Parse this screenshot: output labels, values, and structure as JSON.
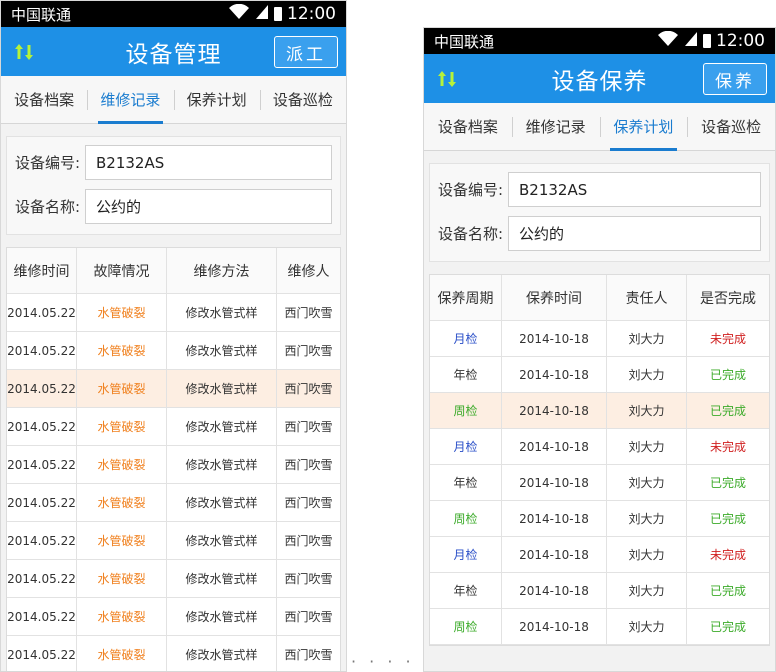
{
  "left": {
    "status": {
      "carrier": "中国联通",
      "time": "12:00"
    },
    "appbar": {
      "title": "设备管理",
      "action": "派工"
    },
    "tabs": [
      "设备档案",
      "维修记录",
      "保养计划",
      "设备巡检"
    ],
    "active_tab": 1,
    "form": [
      {
        "label": "设备编号:",
        "value": "B2132AS"
      },
      {
        "label": "设备名称:",
        "value": "公约的"
      }
    ],
    "table": {
      "headers": [
        "维修时间",
        "故障情况",
        "维修方法",
        "维修人"
      ],
      "highlight_row": 2,
      "rows": [
        [
          "2014.05.22",
          "水管破裂",
          "修改水管式样",
          "西门吹雪"
        ],
        [
          "2014.05.22",
          "水管破裂",
          "修改水管式样",
          "西门吹雪"
        ],
        [
          "2014.05.22",
          "水管破裂",
          "修改水管式样",
          "西门吹雪"
        ],
        [
          "2014.05.22",
          "水管破裂",
          "修改水管式样",
          "西门吹雪"
        ],
        [
          "2014.05.22",
          "水管破裂",
          "修改水管式样",
          "西门吹雪"
        ],
        [
          "2014.05.22",
          "水管破裂",
          "修改水管式样",
          "西门吹雪"
        ],
        [
          "2014.05.22",
          "水管破裂",
          "修改水管式样",
          "西门吹雪"
        ],
        [
          "2014.05.22",
          "水管破裂",
          "修改水管式样",
          "西门吹雪"
        ],
        [
          "2014.05.22",
          "水管破裂",
          "修改水管式样",
          "西门吹雪"
        ],
        [
          "2014.05.22",
          "水管破裂",
          "修改水管式样",
          "西门吹雪"
        ]
      ]
    }
  },
  "right": {
    "status": {
      "carrier": "中国联通",
      "time": "12:00"
    },
    "appbar": {
      "title": "设备保养",
      "action": "保养"
    },
    "tabs": [
      "设备档案",
      "维修记录",
      "保养计划",
      "设备巡检"
    ],
    "active_tab": 2,
    "form": [
      {
        "label": "设备编号:",
        "value": "B2132AS"
      },
      {
        "label": "设备名称:",
        "value": "公约的"
      }
    ],
    "table": {
      "headers": [
        "保养周期",
        "保养时间",
        "责任人",
        "是否完成"
      ],
      "highlight_row": 2,
      "rows": [
        [
          "月检",
          "2014-10-18",
          "刘大力",
          "未完成"
        ],
        [
          "年检",
          "2014-10-18",
          "刘大力",
          "已完成"
        ],
        [
          "周检",
          "2014-10-18",
          "刘大力",
          "已完成"
        ],
        [
          "月检",
          "2014-10-18",
          "刘大力",
          "未完成"
        ],
        [
          "年检",
          "2014-10-18",
          "刘大力",
          "已完成"
        ],
        [
          "周检",
          "2014-10-18",
          "刘大力",
          "已完成"
        ],
        [
          "月检",
          "2014-10-18",
          "刘大力",
          "未完成"
        ],
        [
          "年检",
          "2014-10-18",
          "刘大力",
          "已完成"
        ],
        [
          "周检",
          "2014-10-18",
          "刘大力",
          "已完成"
        ]
      ]
    }
  },
  "colors": {
    "appbar": "#1e90e6",
    "active_tab": "#1a7ccf",
    "fault": "#f0801e",
    "monthly": "#2a4fc8",
    "weekly": "#3cab2a",
    "done": "#3cab2a",
    "not_done": "#d02020",
    "highlight_row": "#fdeee2"
  },
  "icons": {
    "appbar_left": "up-down-arrows-icon",
    "wifi": "wifi-icon",
    "signal": "signal-icon",
    "battery": "battery-icon"
  },
  "pager_dots": "· · · · · ·"
}
